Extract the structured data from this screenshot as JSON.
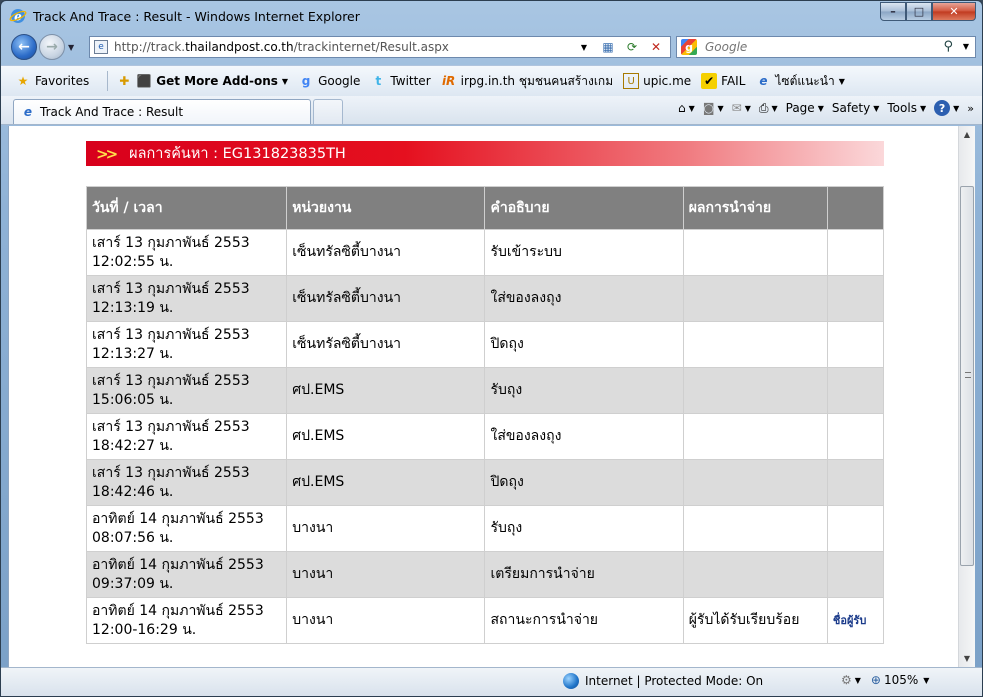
{
  "window": {
    "title": "Track And Trace : Result - Windows Internet Explorer",
    "controls": {
      "minimize": "–",
      "maximize": "□",
      "close": "✕"
    }
  },
  "address_bar": {
    "url_prefix": "http://track.",
    "url_host": "thailandpost.co.th",
    "url_path": "/trackinternet/Result.aspx"
  },
  "search": {
    "placeholder": "Google"
  },
  "favorites_bar": {
    "favorites_label": "Favorites",
    "items": [
      {
        "label": "Get More Add-ons",
        "icon": "addons-icon"
      },
      {
        "label": "Google",
        "icon": "google-icon"
      },
      {
        "label": "Twitter",
        "icon": "twitter-icon"
      },
      {
        "label": "irpg.in.th ชุมชนคนสร้างเกม",
        "icon": "irpg-icon"
      },
      {
        "label": "upic.me",
        "icon": "upic-icon"
      },
      {
        "label": "FAIL",
        "icon": "fail-icon"
      },
      {
        "label": "ไซต์แนะนำ",
        "icon": "ie-icon"
      }
    ]
  },
  "tab": {
    "title": "Track And Trace : Result"
  },
  "command_bar": {
    "page": "Page",
    "safety": "Safety",
    "tools": "Tools"
  },
  "result": {
    "banner": "ผลการค้นหา : EG131823835TH",
    "columns": [
      "วันที่ / เวลา",
      "หน่วยงาน",
      "คำอธิบาย",
      "ผลการนำจ่าย",
      ""
    ],
    "rows": [
      {
        "date": "เสาร์ 13 กุมภาพันธ์ 2553",
        "time": "12:02:55 น.",
        "unit": "เซ็นทรัลซิตี้บางนา",
        "desc": "รับเข้าระบบ",
        "result": "",
        "link": ""
      },
      {
        "date": "เสาร์ 13 กุมภาพันธ์ 2553",
        "time": "12:13:19 น.",
        "unit": "เซ็นทรัลซิตี้บางนา",
        "desc": "ใส่ของลงถุง",
        "result": "",
        "link": ""
      },
      {
        "date": "เสาร์ 13 กุมภาพันธ์ 2553",
        "time": "12:13:27 น.",
        "unit": "เซ็นทรัลซิตี้บางนา",
        "desc": "ปิดถุง",
        "result": "",
        "link": ""
      },
      {
        "date": "เสาร์ 13 กุมภาพันธ์ 2553",
        "time": "15:06:05 น.",
        "unit": "ศป.EMS",
        "desc": "รับถุง",
        "result": "",
        "link": ""
      },
      {
        "date": "เสาร์ 13 กุมภาพันธ์ 2553",
        "time": "18:42:27 น.",
        "unit": "ศป.EMS",
        "desc": "ใส่ของลงถุง",
        "result": "",
        "link": ""
      },
      {
        "date": "เสาร์ 13 กุมภาพันธ์ 2553",
        "time": "18:42:46 น.",
        "unit": "ศป.EMS",
        "desc": "ปิดถุง",
        "result": "",
        "link": ""
      },
      {
        "date": "อาทิตย์ 14 กุมภาพันธ์ 2553",
        "time": "08:07:56 น.",
        "unit": "บางนา",
        "desc": "รับถุง",
        "result": "",
        "link": ""
      },
      {
        "date": "อาทิตย์ 14 กุมภาพันธ์ 2553",
        "time": "09:37:09 น.",
        "unit": "บางนา",
        "desc": "เตรียมการนำจ่าย",
        "result": "",
        "link": ""
      },
      {
        "date": "อาทิตย์ 14 กุมภาพันธ์ 2553",
        "time": "12:00-16:29 น.",
        "unit": "บางนา",
        "desc": "สถานะการนำจ่าย",
        "result": "ผู้รับได้รับเรียบร้อย",
        "link": "ชื่อผู้รับ"
      }
    ]
  },
  "status_bar": {
    "zone": "Internet | Protected Mode: On",
    "zoom": "105%"
  },
  "colors": {
    "banner_red": "#d8001c",
    "header_gray": "#808080",
    "row_alt": "#dcdcdc"
  }
}
